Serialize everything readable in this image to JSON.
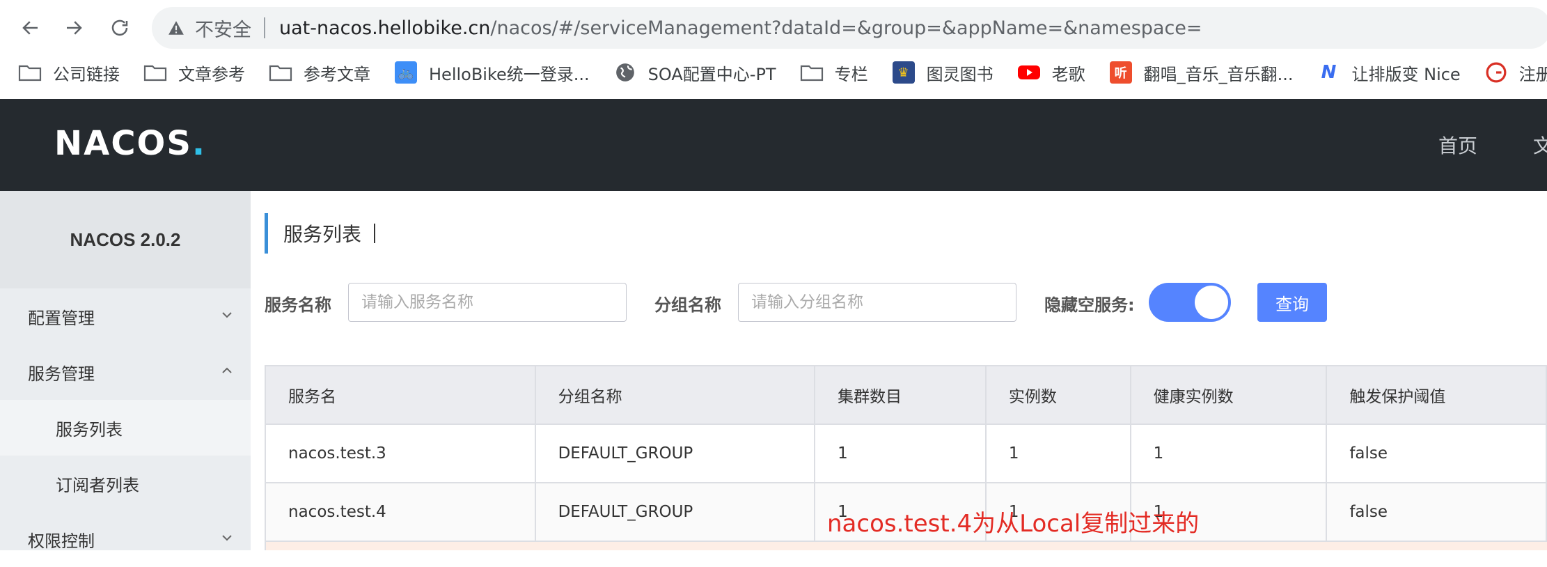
{
  "browser": {
    "insecure_label": "不安全",
    "url_host": "uat-nacos.hellobike.cn",
    "url_path": "/nacos/#/serviceManagement?dataId=&group=&appName=&namespace=",
    "bookmarks": [
      {
        "label": "公司链接",
        "icon": "folder-icon"
      },
      {
        "label": "文章参考",
        "icon": "folder-icon"
      },
      {
        "label": "参考文章",
        "icon": "folder-icon"
      },
      {
        "label": "HelloBike统一登录...",
        "icon": "bike-icon"
      },
      {
        "label": "SOA配置中心-PT",
        "icon": "globe-icon"
      },
      {
        "label": "专栏",
        "icon": "folder-icon"
      },
      {
        "label": "图灵图书",
        "icon": "book-icon"
      },
      {
        "label": "老歌",
        "icon": "youtube-icon"
      },
      {
        "label": "翻唱_音乐_音乐翻...",
        "icon": "music-icon"
      },
      {
        "label": "让排版变 Nice",
        "icon": "nice-icon"
      },
      {
        "label": "注册 - G",
        "icon": "g-icon"
      }
    ]
  },
  "header": {
    "logo": "NACOS",
    "nav_home": "首页",
    "nav_doc_partial": "文"
  },
  "sidebar": {
    "version": "NACOS 2.0.2",
    "config_mgmt": "配置管理",
    "service_mgmt": "服务管理",
    "service_list": "服务列表",
    "subscriber_list": "订阅者列表",
    "access_control": "权限控制"
  },
  "main": {
    "title": "服务列表",
    "service_name_label": "服务名称",
    "service_name_placeholder": "请输入服务名称",
    "group_name_label": "分组名称",
    "group_name_placeholder": "请输入分组名称",
    "hide_empty_label": "隐藏空服务:",
    "hide_empty_on": true,
    "query_button": "查询"
  },
  "table": {
    "headers": [
      "服务名",
      "分组名称",
      "集群数目",
      "实例数",
      "健康实例数",
      "触发保护阈值"
    ],
    "rows": [
      [
        "nacos.test.3",
        "DEFAULT_GROUP",
        "1",
        "1",
        "1",
        "false"
      ],
      [
        "nacos.test.4",
        "DEFAULT_GROUP",
        "1",
        "1",
        "1",
        "false"
      ]
    ]
  },
  "annotation": "nacos.test.4为从Local复制过来的",
  "colors": {
    "header_bg": "#252a2f",
    "accent_blue": "#5584ff",
    "annotation_red": "#e32b24"
  }
}
